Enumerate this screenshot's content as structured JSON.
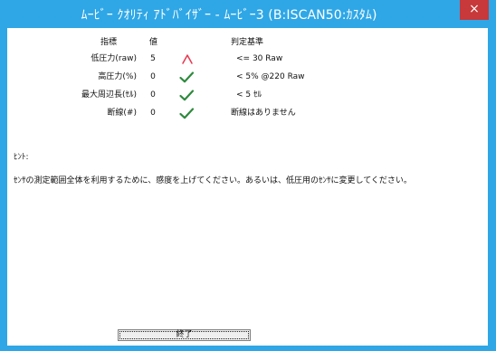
{
  "window": {
    "title": "ﾑｰﾋﾞｰ ｸｵﾘﾃｨ ｱﾄﾞﾊﾞｲｻﾞｰ - ﾑｰﾋﾞｰ3 (B:ISCAN50:ｶｽﾀﾑ)",
    "close_label": "×"
  },
  "table": {
    "headers": {
      "metric": "指標",
      "value": "値",
      "criterion": "判定基準"
    },
    "rows": [
      {
        "name": "低圧力(raw)",
        "value": "5",
        "criterion": "<= 30 Raw",
        "status": "warning-icon"
      },
      {
        "name": "高圧力(%)",
        "value": "0",
        "criterion": "< 5% @220 Raw",
        "status": "check-icon"
      },
      {
        "name": "最大周辺長(ｾﾙ)",
        "value": "0",
        "criterion": "< 5 ｾﾙ",
        "status": "check-icon"
      },
      {
        "name": "断線(#)",
        "value": "0",
        "criterion": "断線はありません",
        "status": "check-icon"
      }
    ]
  },
  "hint": {
    "label": "ﾋﾝﾄ:",
    "text": "ｾﾝｻの測定範囲全体を利用するために、感度を上げてください。あるいは、低圧用のｾﾝｻに変更してください。"
  },
  "footer": {
    "finish_label": "終了"
  },
  "colors": {
    "title_bar": "#2fa7e6",
    "close_button": "#c7393a",
    "check": "#2d8a3d",
    "warning": "#e8384f"
  }
}
